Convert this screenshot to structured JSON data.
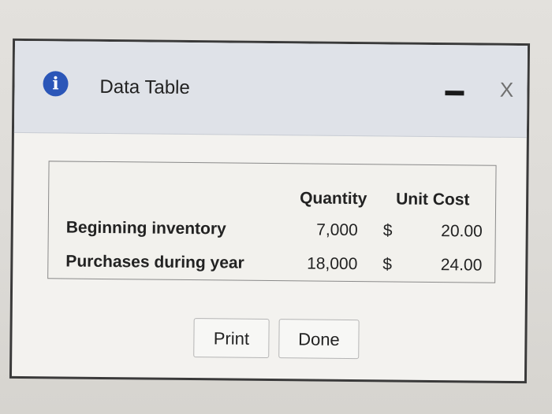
{
  "dialog": {
    "title": "Data Table",
    "icon": "info-icon",
    "minimize_symbol": "-",
    "close_symbol": "X"
  },
  "table": {
    "headers": {
      "quantity": "Quantity",
      "unit_cost": "Unit Cost"
    },
    "rows": [
      {
        "label": "Beginning inventory",
        "quantity": "7,000",
        "currency": "$",
        "unit_cost": "20.00"
      },
      {
        "label": "Purchases during year",
        "quantity": "18,000",
        "currency": "$",
        "unit_cost": "24.00"
      }
    ]
  },
  "buttons": {
    "print": "Print",
    "done": "Done"
  },
  "colors": {
    "icon_blue": "#2b56b8",
    "titlebar": "#dfe2e8",
    "dialog_bg": "#f3f2ef"
  }
}
